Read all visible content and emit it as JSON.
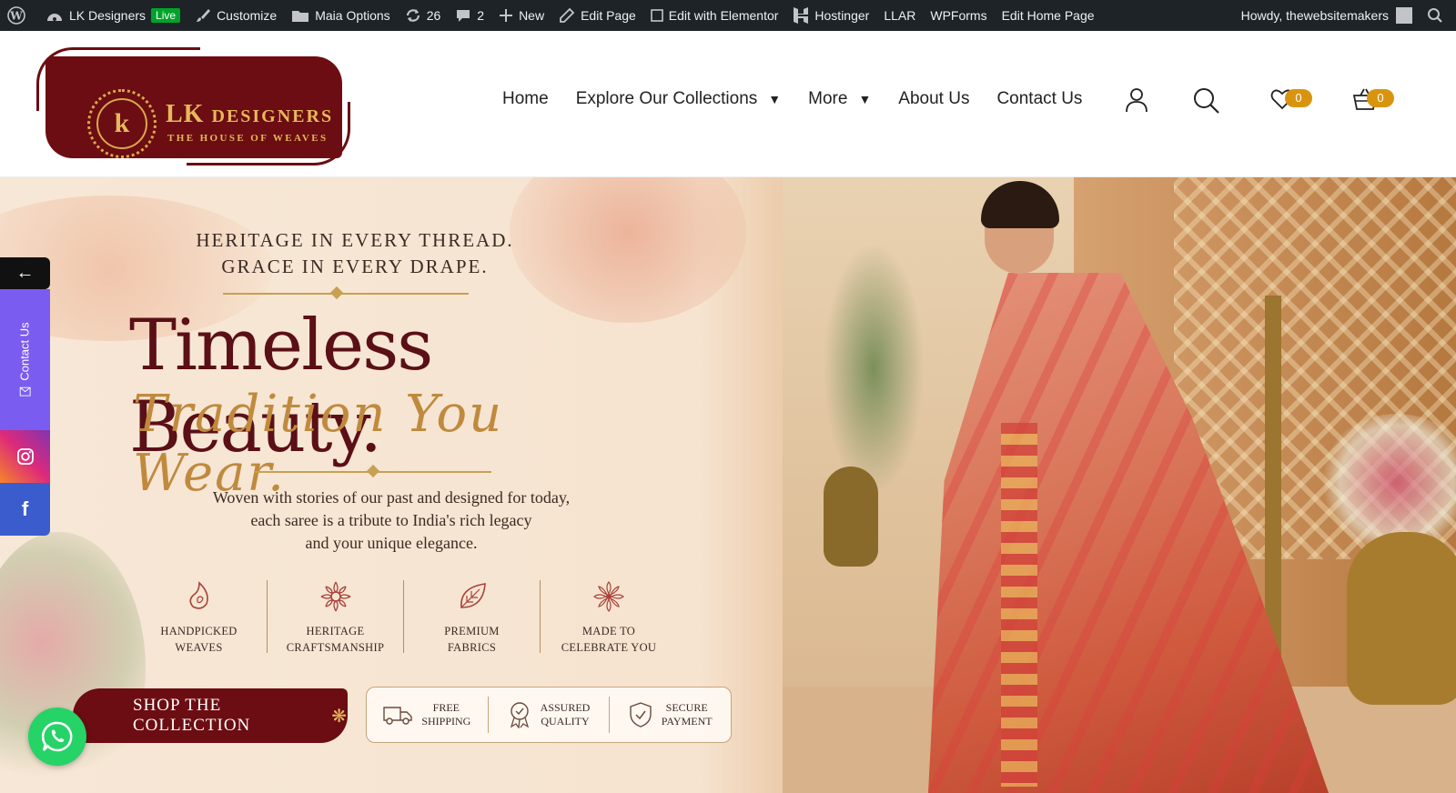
{
  "adminbar": {
    "site_name": "LK Designers",
    "live_badge": "Live",
    "customize": "Customize",
    "maia_options": "Maia Options",
    "updates_count": "26",
    "comments_count": "2",
    "new": "New",
    "edit_page": "Edit Page",
    "edit_elementor": "Edit with Elementor",
    "hostinger": "Hostinger",
    "llar": "LLAR",
    "wpforms": "WPForms",
    "edit_home": "Edit Home Page",
    "howdy": "Howdy, thewebsitemakers"
  },
  "logo": {
    "monogram": "k",
    "title_lk": "LK",
    "title_designers": "DESIGNERS",
    "subtitle": "THE HOUSE OF WEAVES"
  },
  "nav": {
    "home": "Home",
    "collections": "Explore Our Collections",
    "more": "More",
    "about": "About Us",
    "contact": "Contact Us",
    "caret": "▼"
  },
  "header_icons": {
    "wishlist_count": "0",
    "cart_count": "0"
  },
  "hero": {
    "kicker_line1": "HERITAGE IN EVERY THREAD.",
    "kicker_line2": "GRACE IN EVERY DRAPE.",
    "headline": "Timeless Beauty.",
    "script": "Tradition You Wear.",
    "desc_line1": "Woven with stories of our past and designed for today,",
    "desc_line2": "each saree is a tribute to India's rich legacy",
    "desc_line3": "and your unique elegance.",
    "features": [
      {
        "line1": "HANDPICKED",
        "line2": "WEAVES",
        "icon": "paisley-icon"
      },
      {
        "line1": "HERITAGE",
        "line2": "CRAFTSMANSHIP",
        "icon": "mandala-icon"
      },
      {
        "line1": "PREMIUM",
        "line2": "FABRICS",
        "icon": "leaf-icon"
      },
      {
        "line1": "MADE TO",
        "line2": "CELEBRATE YOU",
        "icon": "flower-icon"
      }
    ],
    "cta": "SHOP THE COLLECTION",
    "perks": [
      {
        "line1": "FREE",
        "line2": "SHIPPING",
        "icon": "truck-icon"
      },
      {
        "line1": "ASSURED",
        "line2": "QUALITY",
        "icon": "award-icon"
      },
      {
        "line1": "SECURE",
        "line2": "PAYMENT",
        "icon": "shield-check-icon"
      }
    ]
  },
  "sidebar": {
    "back_arrow": "←",
    "contact": "Contact Us",
    "facebook": "f"
  },
  "colors": {
    "adminbar": "#1d2327",
    "brand_maroon": "#6b0d12",
    "gold": "#e6b85c",
    "badge": "#d9940f",
    "contact_purple": "#7b5cf0",
    "facebook": "#3b5ccd",
    "whatsapp": "#25d366"
  }
}
